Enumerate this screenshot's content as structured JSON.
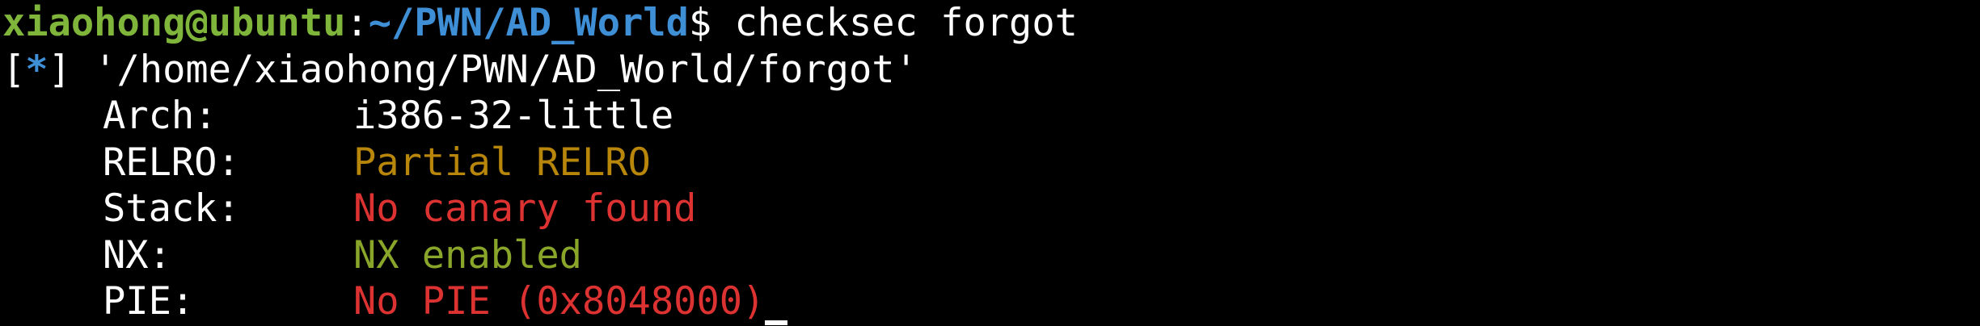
{
  "prompt": {
    "user_host": "xiaohong@ubuntu",
    "separator": ":",
    "path": "~/PWN/AD_World",
    "symbol": "$",
    "command": " checksec forgot"
  },
  "output": {
    "info_open": "[",
    "info_star": "*",
    "info_close": "]",
    "file_line": " '/home/xiaohong/PWN/AD_World/forgot'",
    "rows": [
      {
        "key": "Arch:",
        "value": "i386-32-little",
        "color": "#ffffff"
      },
      {
        "key": "RELRO:",
        "value": "Partial RELRO",
        "color": "#b8860b"
      },
      {
        "key": "Stack:",
        "value": "No canary found",
        "color": "#dc3232"
      },
      {
        "key": "NX:",
        "value": "NX enabled",
        "color": "#8aa62a"
      },
      {
        "key": "PIE:",
        "value": "No PIE (0x8048000)",
        "color": "#dc3232"
      }
    ]
  },
  "colors": {
    "background": "#000000",
    "prompt_user": "#7fb53a",
    "prompt_path": "#3f8fd6",
    "text": "#ffffff"
  }
}
